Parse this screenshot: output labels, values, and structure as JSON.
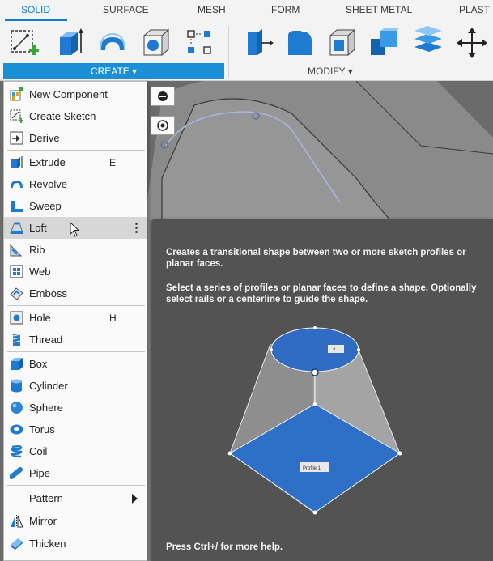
{
  "tabs": [
    "SOLID",
    "SURFACE",
    "MESH",
    "FORM",
    "SHEET METAL",
    "PLAST"
  ],
  "toolbar": {
    "create_label": "CREATE ▾",
    "modify_label": "MODIFY ▾"
  },
  "colors": {
    "accent": "#1b8fd6",
    "tab_active": "#0a7fd2",
    "tooltip_bg": "#535353",
    "loft_face": "#2e6fc8"
  },
  "menu": {
    "items": [
      {
        "label": "New Component",
        "shortcut": "",
        "icon": "new-component-icon"
      },
      {
        "label": "Create Sketch",
        "shortcut": "",
        "icon": "create-sketch-icon"
      },
      {
        "label": "Derive",
        "shortcut": "",
        "icon": "derive-icon"
      },
      {
        "label": "Extrude",
        "shortcut": "E",
        "icon": "extrude-icon"
      },
      {
        "label": "Revolve",
        "shortcut": "",
        "icon": "revolve-icon"
      },
      {
        "label": "Sweep",
        "shortcut": "",
        "icon": "sweep-icon"
      },
      {
        "label": "Loft",
        "shortcut": "",
        "icon": "loft-icon",
        "more": "⋮"
      },
      {
        "label": "Rib",
        "shortcut": "",
        "icon": "rib-icon"
      },
      {
        "label": "Web",
        "shortcut": "",
        "icon": "web-icon"
      },
      {
        "label": "Emboss",
        "shortcut": "",
        "icon": "emboss-icon"
      },
      {
        "label": "Hole",
        "shortcut": "H",
        "icon": "hole-icon"
      },
      {
        "label": "Thread",
        "shortcut": "",
        "icon": "thread-icon"
      },
      {
        "label": "Box",
        "shortcut": "",
        "icon": "box-icon"
      },
      {
        "label": "Cylinder",
        "shortcut": "",
        "icon": "cylinder-icon"
      },
      {
        "label": "Sphere",
        "shortcut": "",
        "icon": "sphere-icon"
      },
      {
        "label": "Torus",
        "shortcut": "",
        "icon": "torus-icon"
      },
      {
        "label": "Coil",
        "shortcut": "",
        "icon": "coil-icon"
      },
      {
        "label": "Pipe",
        "shortcut": "",
        "icon": "pipe-icon"
      },
      {
        "label": "Pattern",
        "shortcut": "",
        "icon": "",
        "submenu": true
      },
      {
        "label": "Mirror",
        "shortcut": "",
        "icon": "mirror-icon"
      },
      {
        "label": "Thicken",
        "shortcut": "",
        "icon": "thicken-icon"
      }
    ]
  },
  "tooltip": {
    "line1": "Creates a transitional shape between two or more sketch profiles or planar faces.",
    "line2": "Select a series of profiles or planar faces to define a shape. Optionally select rails or a centerline to guide the shape.",
    "footer": "Press Ctrl+/ for more help.",
    "profile_label": "Profile 1",
    "profile2_label": "2"
  }
}
